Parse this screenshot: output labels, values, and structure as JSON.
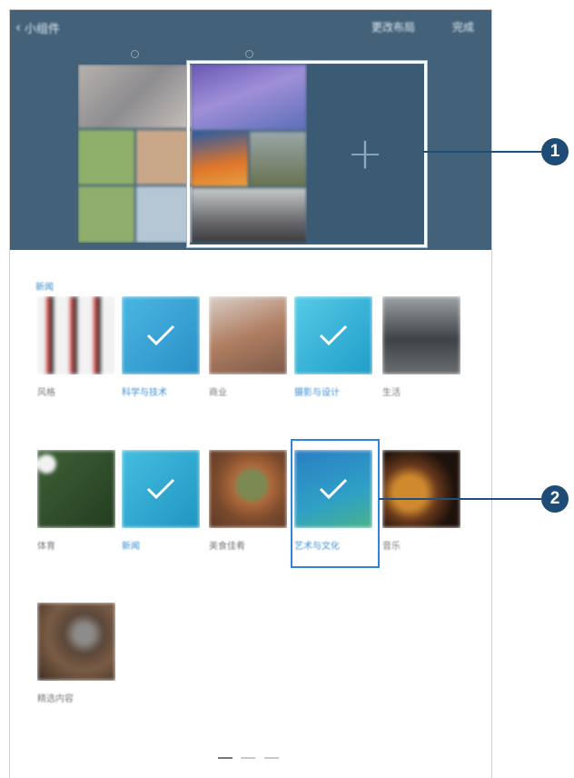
{
  "topbar": {
    "back_label": "小组件",
    "change_layout_label": "更改布局",
    "done_label": "完成"
  },
  "section": {
    "label": "新闻"
  },
  "thumbnails": [
    {
      "caption": "风格",
      "selected": false,
      "color": "#e9e9e9"
    },
    {
      "caption": "科学与技术",
      "selected": true,
      "color": "#3ba6d8"
    },
    {
      "caption": "商业",
      "selected": false,
      "color": "#b98b6e"
    },
    {
      "caption": "摄影与设计",
      "selected": true,
      "color": "#3db8dc"
    },
    {
      "caption": "生活",
      "selected": false,
      "color": "#555a5e"
    },
    {
      "caption": "体育",
      "selected": false,
      "color": "#3e5e35"
    },
    {
      "caption": "新闻",
      "selected": true,
      "color": "#32a9cf"
    },
    {
      "caption": "美食佳肴",
      "selected": false,
      "color": "#8a5a3a"
    },
    {
      "caption": "艺术与文化",
      "selected": true,
      "color": "#2f8fc7"
    },
    {
      "caption": "音乐",
      "selected": false,
      "color": "#4a2c1a"
    },
    {
      "caption": "精选内容",
      "selected": false,
      "color": "#5c4635"
    }
  ],
  "add_slot": {
    "icon": "plus-icon"
  },
  "callouts": [
    {
      "number": "1"
    },
    {
      "number": "2"
    }
  ],
  "page_indicator": {
    "pages": 3,
    "active": 0
  },
  "colors": {
    "header_bg": "#43627a",
    "accent": "#3f8fd2",
    "callout_bg": "#1e4c76"
  }
}
